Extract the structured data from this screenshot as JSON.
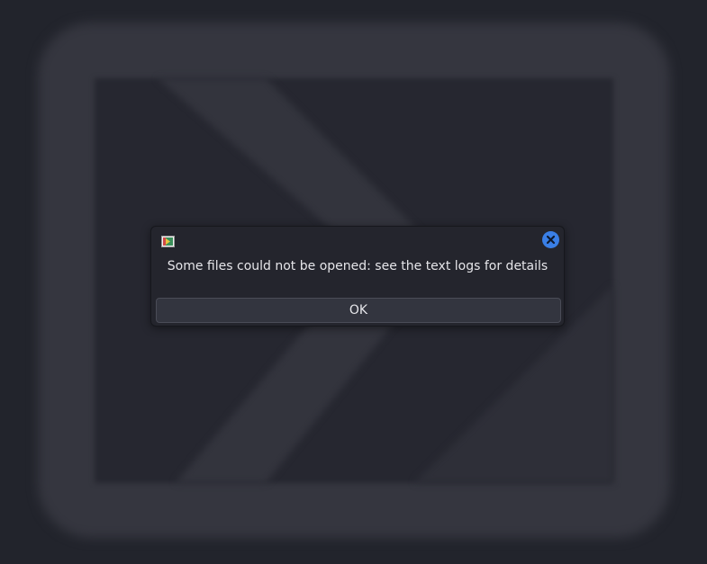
{
  "dialog": {
    "message": "Some files could not be opened: see the text logs for details",
    "ok_label": "OK",
    "app_icon": "app-logo-icon",
    "close_icon": "close-icon"
  },
  "colors": {
    "background": "#22242c",
    "dialog_background": "#24252d",
    "button_background": "#33353f",
    "close_accent": "#3a7fe6",
    "text": "#e6e6ea"
  }
}
